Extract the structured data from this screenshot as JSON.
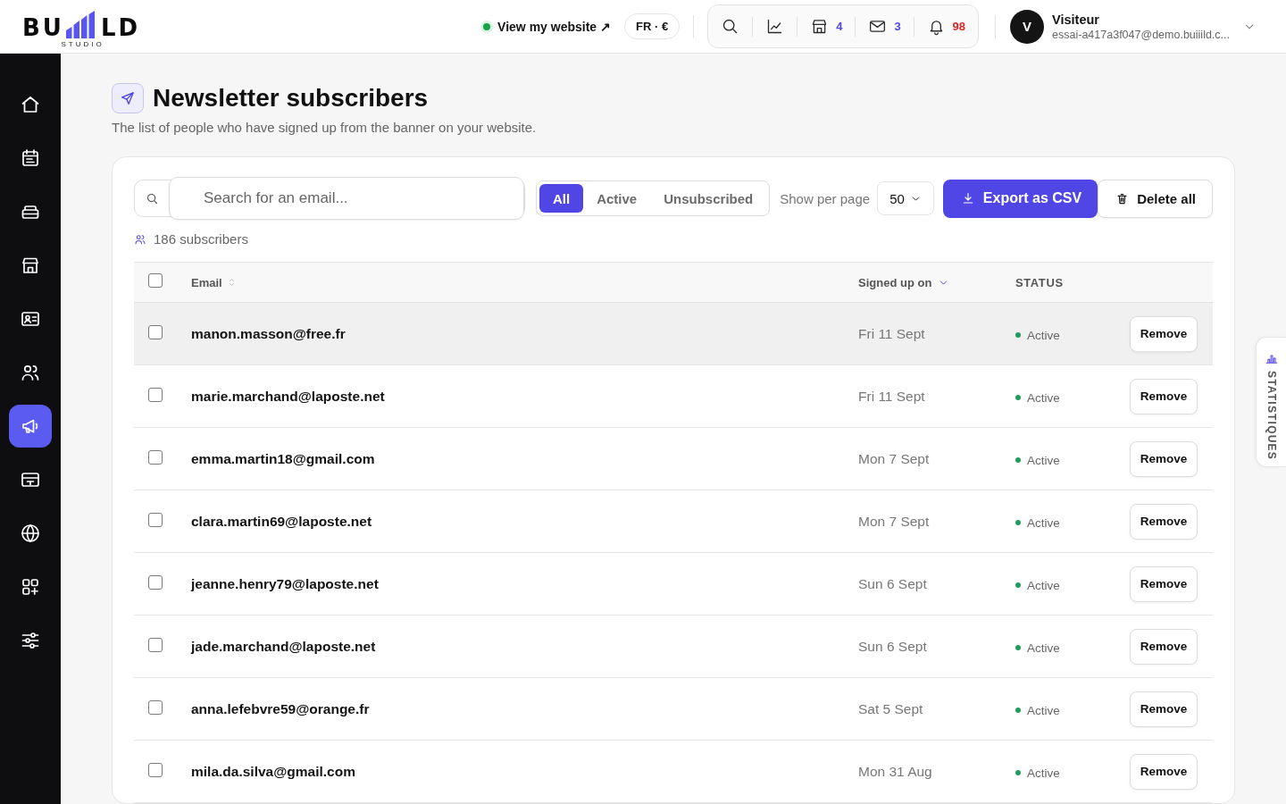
{
  "header": {
    "logo": {
      "left": "BU",
      "right": "LD",
      "tagline": "STUDIO"
    },
    "site_link": "View my website ↗",
    "locale": "FR · €",
    "notifications": [
      {
        "count": "4",
        "color": "#4f46e5"
      },
      {
        "count": "3",
        "color": "#4f46e5"
      },
      {
        "count": "98",
        "color": "#dc2626"
      }
    ],
    "user": {
      "initial": "V",
      "name": "Visiteur",
      "email": "essai-a417a3f047@demo.buiiild.c..."
    }
  },
  "sidebar": {
    "items": [
      {
        "selected": false
      },
      {
        "selected": false
      },
      {
        "selected": false
      },
      {
        "selected": false
      },
      {
        "selected": false
      },
      {
        "selected": false
      },
      {
        "selected": true
      },
      {
        "selected": false
      },
      {
        "selected": false
      },
      {
        "selected": false
      },
      {
        "selected": false
      }
    ]
  },
  "page": {
    "title": "Newsletter subscribers",
    "subtitle": "The list of people who have signed up from the banner on your website."
  },
  "toolbar": {
    "search": {
      "placeholder": "Search for an email..."
    },
    "filters": [
      {
        "label": "All",
        "selected": true
      },
      {
        "label": "Active",
        "selected": false
      },
      {
        "label": "Unsubscribed",
        "selected": false
      }
    ],
    "per_page_label": "Show per page",
    "per_page": "50",
    "export_button": "Export as CSV",
    "delete_button": "Delete all"
  },
  "summary": "186 subscribers",
  "table": {
    "select_all": {
      "checked": false
    },
    "columns": [
      {
        "label": "Email",
        "sorted": false
      },
      {
        "label": "Signed up on",
        "sorted": true
      },
      {
        "label": "STATUS"
      }
    ],
    "rows": [
      {
        "email": "manon.masson@free.fr",
        "date": "Fri 11 Sept",
        "status": "Active",
        "color": "#1e9e5a",
        "checked": false,
        "highlighted": true,
        "action": "Remove"
      },
      {
        "email": "marie.marchand@laposte.net",
        "date": "Fri 11 Sept",
        "status": "Active",
        "color": "#1e9e5a",
        "checked": false,
        "highlighted": false,
        "action": "Remove"
      },
      {
        "email": "emma.martin18@gmail.com",
        "date": "Mon 7 Sept",
        "status": "Active",
        "color": "#1e9e5a",
        "checked": false,
        "highlighted": false,
        "action": "Remove"
      },
      {
        "email": "clara.martin69@laposte.net",
        "date": "Mon 7 Sept",
        "status": "Active",
        "color": "#1e9e5a",
        "checked": false,
        "highlighted": false,
        "action": "Remove"
      },
      {
        "email": "jeanne.henry79@laposte.net",
        "date": "Sun 6 Sept",
        "status": "Active",
        "color": "#1e9e5a",
        "checked": false,
        "highlighted": false,
        "action": "Remove"
      },
      {
        "email": "jade.marchand@laposte.net",
        "date": "Sun 6 Sept",
        "status": "Active",
        "color": "#1e9e5a",
        "checked": false,
        "highlighted": false,
        "action": "Remove"
      },
      {
        "email": "anna.lefebvre59@orange.fr",
        "date": "Sat 5 Sept",
        "status": "Active",
        "color": "#1e9e5a",
        "checked": false,
        "highlighted": false,
        "action": "Remove"
      },
      {
        "email": "mila.da.silva@gmail.com",
        "date": "Mon 31 Aug",
        "status": "Active",
        "color": "#1e9e5a",
        "checked": false,
        "highlighted": false,
        "action": "Remove"
      }
    ]
  },
  "side_tab": "STATISTIQUES"
}
